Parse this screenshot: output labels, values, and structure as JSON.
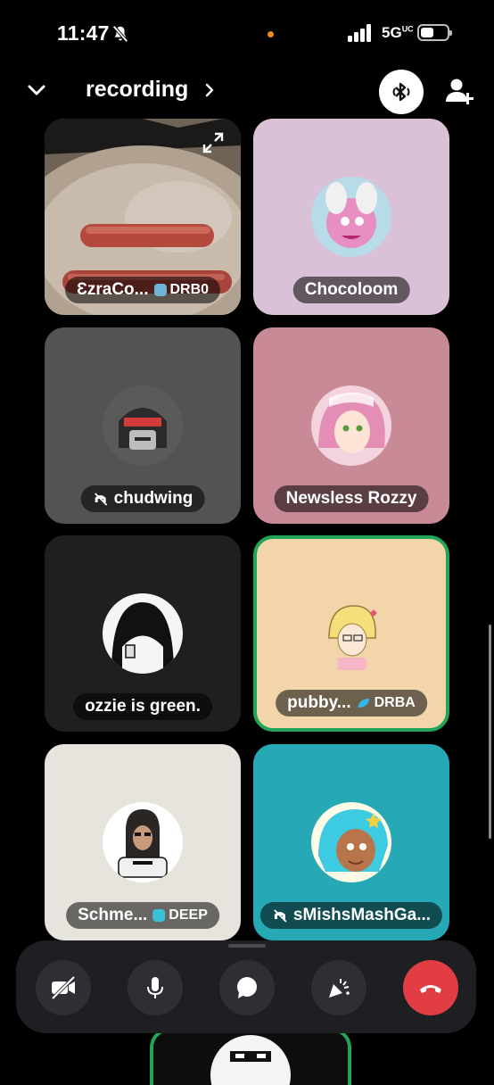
{
  "status_bar": {
    "time": "11:47",
    "network": "5G",
    "network_sup": "UC",
    "icons": [
      "bell-slash-icon",
      "recording-dot",
      "signal-icon",
      "battery-icon"
    ]
  },
  "header": {
    "channel_name": "recording",
    "icons": [
      "chevron-down-icon",
      "chevron-right-icon",
      "bluetooth-audio-icon",
      "add-user-icon"
    ]
  },
  "participants": [
    {
      "name": "ƐzraCo...",
      "tag": "DRB0",
      "tag_color": "#6fb4d6",
      "bg": "#8d7b6c",
      "stream": true
    },
    {
      "name": "Chocoloom",
      "bg": "#d9c2d7"
    },
    {
      "name": "chudwing",
      "muted": true,
      "bg": "#535353"
    },
    {
      "name": "Newsless Rozzy",
      "bg": "#c98a97"
    },
    {
      "name": "ozzie is green.",
      "bg": "#1f1f1f"
    },
    {
      "name": "pubby...",
      "tag": "DRBA",
      "tag_color": "#35b8e6",
      "bg": "#f2d6aa",
      "speaking": true
    },
    {
      "name": "Schme...",
      "tag": "DEEP",
      "tag_color": "#39c1d6",
      "bg": "#e7e4de"
    },
    {
      "name": "sMishsMashGa...",
      "muted": true,
      "bg": "#26a9b5"
    }
  ],
  "controls": {
    "buttons": [
      "camera-off",
      "microphone",
      "chat",
      "activities",
      "hang-up"
    ]
  },
  "colors": {
    "speaking": "#23a559",
    "hangup": "#e23d45",
    "control_bg": "#2e2f34"
  }
}
